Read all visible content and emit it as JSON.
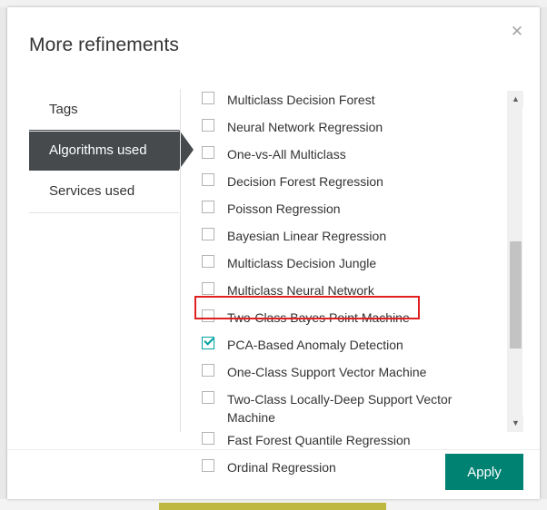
{
  "window": {
    "backdrop_color": "#e9e9e9"
  },
  "dialog": {
    "title": "More refinements",
    "close_icon": "close-icon",
    "close_glyph": "✕",
    "accent_color": "#008272",
    "highlight_color": "#e02020"
  },
  "tabs": [
    {
      "label": "Tags",
      "selected": false
    },
    {
      "label": "Algorithms used",
      "selected": true
    },
    {
      "label": "Services used",
      "selected": false
    }
  ],
  "list": {
    "items": [
      {
        "label": "Multiclass Decision Forest",
        "checked": false
      },
      {
        "label": "Neural Network Regression",
        "checked": false
      },
      {
        "label": "One-vs-All Multiclass",
        "checked": false
      },
      {
        "label": "Decision Forest Regression",
        "checked": false
      },
      {
        "label": "Poisson Regression",
        "checked": false
      },
      {
        "label": "Bayesian Linear Regression",
        "checked": false
      },
      {
        "label": "Multiclass Decision Jungle",
        "checked": false
      },
      {
        "label": "Multiclass Neural Network",
        "checked": false
      },
      {
        "label": "Two-Class Bayes Point Machine",
        "checked": false
      },
      {
        "label": "PCA-Based Anomaly Detection",
        "checked": true
      },
      {
        "label": "One-Class Support Vector Machine",
        "checked": false
      },
      {
        "label": "Two-Class Locally-Deep Support Vector Machine",
        "checked": false
      },
      {
        "label": "Fast Forest Quantile Regression",
        "checked": false
      },
      {
        "label": "Ordinal Regression",
        "checked": false
      }
    ]
  },
  "scrollbar": {
    "up_glyph": "▲",
    "down_glyph": "▼"
  },
  "footer": {
    "apply_label": "Apply"
  }
}
